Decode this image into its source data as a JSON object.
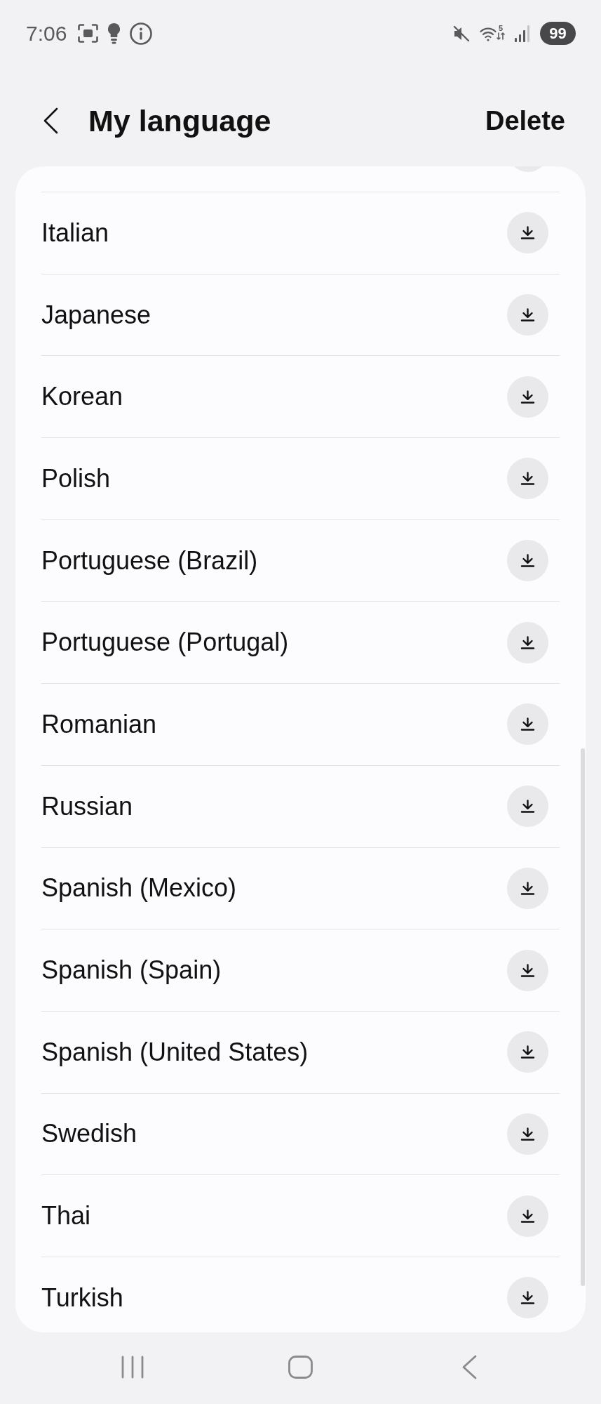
{
  "status_bar": {
    "time": "7:06",
    "wifi_band": "5",
    "battery": "99"
  },
  "header": {
    "title": "My language",
    "action": "Delete"
  },
  "languages": [
    {
      "name": "Italian"
    },
    {
      "name": "Japanese"
    },
    {
      "name": "Korean"
    },
    {
      "name": "Polish"
    },
    {
      "name": "Portuguese (Brazil)"
    },
    {
      "name": "Portuguese (Portugal)"
    },
    {
      "name": "Romanian"
    },
    {
      "name": "Russian"
    },
    {
      "name": "Spanish (Mexico)"
    },
    {
      "name": "Spanish (Spain)"
    },
    {
      "name": "Spanish (United States)"
    },
    {
      "name": "Swedish"
    },
    {
      "name": "Thai"
    },
    {
      "name": "Turkish"
    }
  ]
}
